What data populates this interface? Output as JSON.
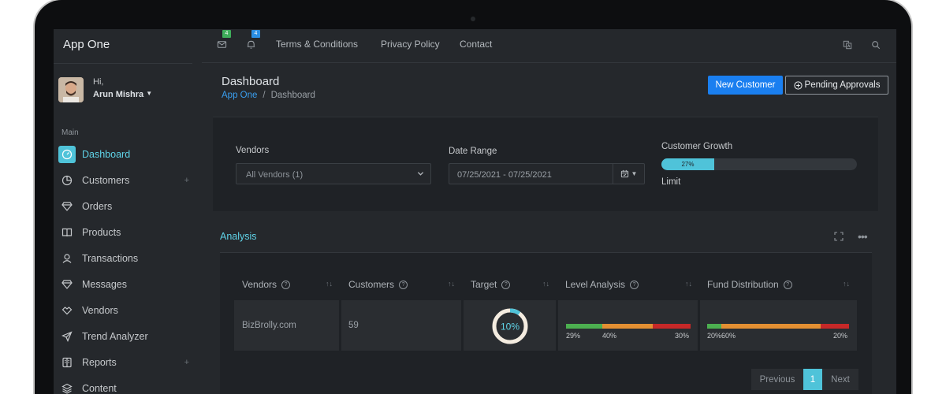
{
  "app": {
    "title": "App One"
  },
  "user": {
    "greeting": "Hi,",
    "name": "Arun Mishra"
  },
  "sidebar": {
    "section_label": "Main",
    "items": [
      {
        "label": "Dashboard",
        "icon": "dashboard-gauge-icon",
        "active": true
      },
      {
        "label": "Customers",
        "icon": "pie-chart-icon",
        "expandable": "+"
      },
      {
        "label": "Orders",
        "icon": "diamond-icon"
      },
      {
        "label": "Products",
        "icon": "book-icon"
      },
      {
        "label": "Transactions",
        "icon": "user-icon"
      },
      {
        "label": "Messages",
        "icon": "diamond-icon"
      },
      {
        "label": "Vendors",
        "icon": "handshake-icon"
      },
      {
        "label": "Trend Analyzer",
        "icon": "send-icon"
      },
      {
        "label": "Reports",
        "icon": "book-open-icon",
        "expandable": "+"
      },
      {
        "label": "Content",
        "icon": "layers-icon"
      }
    ]
  },
  "topbar": {
    "mail_badge": "4",
    "bell_badge": "4",
    "links": [
      "Terms & Conditions",
      "Privacy Policy",
      "Contact"
    ],
    "colors": {
      "mail_badge": "#3fae5b",
      "bell_badge": "#2b8fe5"
    }
  },
  "page": {
    "title": "Dashboard",
    "breadcrumb": [
      "App One",
      "Dashboard"
    ],
    "new_customer_label": "New Customer",
    "pending_approvals_label": "Pending Approvals"
  },
  "filters": {
    "vendors_label": "Vendors",
    "vendors_value": "All Vendors (1)",
    "date_range_label": "Date Range",
    "date_range_value": "07/25/2021 - 07/25/2021",
    "customer_growth_label": "Customer Growth",
    "customer_growth_value": "27%",
    "customer_growth_fraction": 0.27,
    "limit_label": "Limit"
  },
  "analysis": {
    "title": "Analysis",
    "columns": [
      "Vendors",
      "Customers",
      "Target",
      "Level Analysis",
      "Fund Distribution"
    ],
    "row": {
      "vendor": "BizBrolly.com",
      "customers": "59",
      "target": "10%",
      "target_fraction": 0.1,
      "level_analysis": [
        {
          "label": "29%",
          "value": 29,
          "color": "#4caf50"
        },
        {
          "label": "40%",
          "value": 40,
          "color": "#e38f32"
        },
        {
          "label": "30%",
          "value": 30,
          "color": "#c62828"
        }
      ],
      "fund_distribution": [
        {
          "label": "20%",
          "value": 10,
          "color": "#4caf50"
        },
        {
          "label": "60%",
          "value": 70,
          "color": "#e38f32"
        },
        {
          "label": "20%",
          "value": 20,
          "color": "#c62828"
        }
      ]
    },
    "pagination": {
      "previous": "Previous",
      "current": "1",
      "next": "Next"
    }
  },
  "colors": {
    "accent": "#4fc3d9",
    "primary_button": "#1a7ff0",
    "link": "#3a9ff0"
  }
}
